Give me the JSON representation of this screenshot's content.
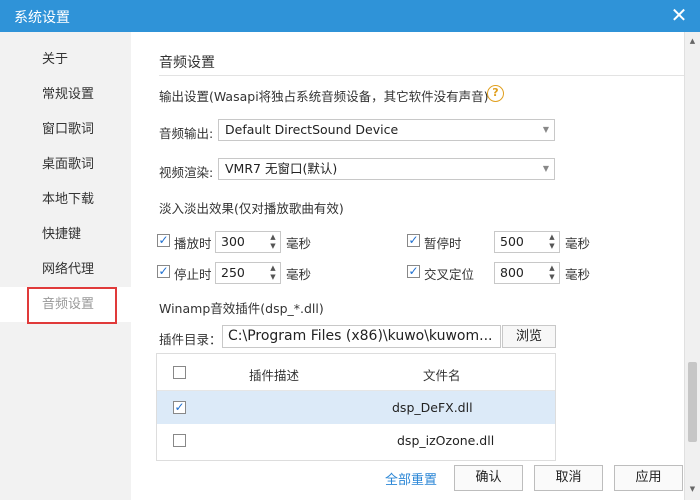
{
  "window": {
    "title": "系统设置",
    "close_glyph": "✕"
  },
  "sidebar": {
    "items": [
      {
        "label": "关于"
      },
      {
        "label": "常规设置"
      },
      {
        "label": "窗口歌词"
      },
      {
        "label": "桌面歌词"
      },
      {
        "label": "本地下载"
      },
      {
        "label": "快捷键"
      },
      {
        "label": "网络代理"
      },
      {
        "label": "音频设置",
        "active": true
      }
    ]
  },
  "audio": {
    "section_title": "音频设置",
    "output_note": "输出设置(Wasapi将独占系统音频设备，其它软件没有声音)",
    "help_glyph": "?",
    "audio_output_label": "音频输出:",
    "audio_output_value": "Default DirectSound Device",
    "video_render_label": "视频渲染:",
    "video_render_value": "VMR7 无窗口(默认)",
    "fade_title": "淡入淡出效果(仅对播放歌曲有效)",
    "unit": "毫秒",
    "fades": [
      {
        "label": "播放时",
        "value": "300",
        "checked": true
      },
      {
        "label": "暂停时",
        "value": "500",
        "checked": true
      },
      {
        "label": "停止时",
        "value": "250",
        "checked": true
      },
      {
        "label": "交叉定位",
        "value": "800",
        "checked": true
      }
    ],
    "winamp_title": "Winamp音效插件(dsp_*.dll)",
    "plugin_dir_label": "插件目录：",
    "plugin_dir_value": "C:\\Program  Files  (x86)\\kuwo\\kuwom...",
    "browse_label": "浏览",
    "table": {
      "col_desc": "插件描述",
      "col_file": "文件名",
      "rows": [
        {
          "file": "dsp_DeFX.dll",
          "checked": true,
          "selected": true
        },
        {
          "file": "dsp_izOzone.dll",
          "checked": false,
          "selected": false
        }
      ]
    }
  },
  "footer": {
    "reset_label": "全部重置",
    "ok_label": "确认",
    "cancel_label": "取消",
    "apply_label": "应用"
  },
  "colors": {
    "titlebar": "#2f93d8",
    "highlight_border": "#e03a3a",
    "link": "#2a86d6",
    "selected_row": "#dceaf8"
  },
  "icons": {
    "close": "close-icon",
    "help": "help-icon",
    "dropdown": "chevron-down-icon",
    "check": "check-icon"
  }
}
